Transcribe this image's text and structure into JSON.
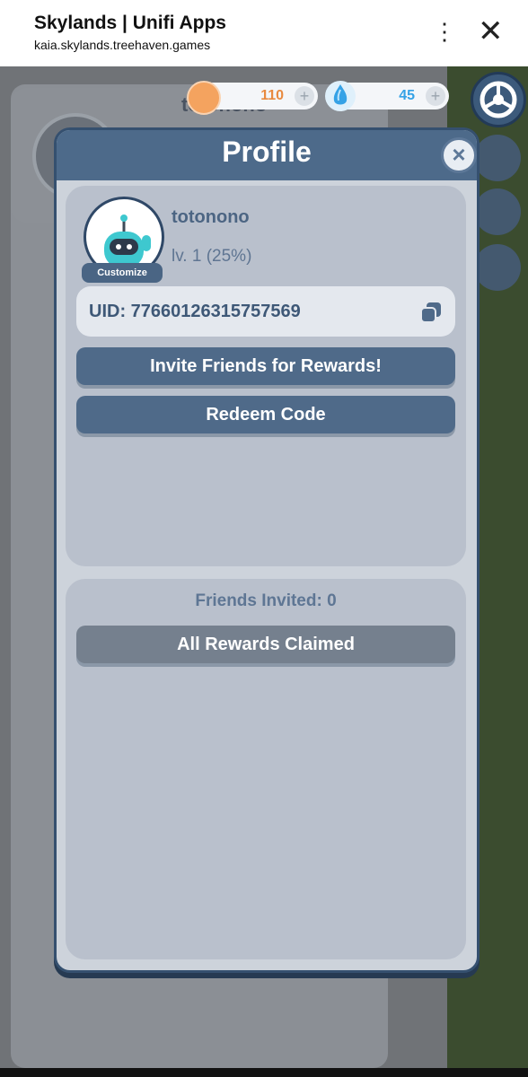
{
  "browser": {
    "title": "Skylands | Unifi Apps",
    "url": "kaia.skylands.treehaven.games"
  },
  "hud": {
    "background_name": "totonono",
    "coins": "110",
    "gems": "45"
  },
  "modal": {
    "title": "Profile",
    "profile": {
      "username": "totonono",
      "level": "lv. 1 (25%)",
      "customize_label": "Customize",
      "uid": "UID: 77660126315757569"
    },
    "buttons": {
      "invite": "Invite Friends for Rewards!",
      "redeem": "Redeem Code"
    },
    "friends": {
      "invited": "Friends Invited: 0",
      "rewards_button": "All Rewards Claimed"
    }
  },
  "colors": {
    "coin": "#f4a35f",
    "gem": "#35a2e6",
    "primary_button": "#4f6a89",
    "modal_header": "#4d6a8a"
  }
}
